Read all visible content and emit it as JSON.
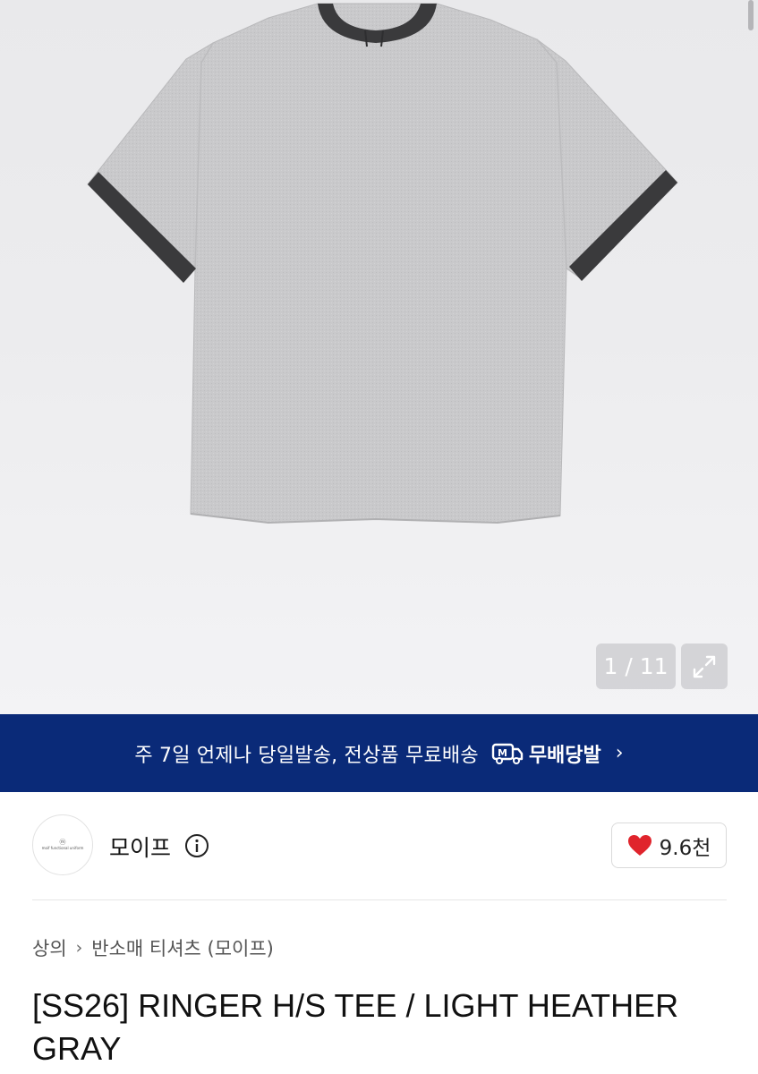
{
  "gallery": {
    "page_counter": "1 / 11",
    "image_alt": "Ringer H/S tee in light heather gray"
  },
  "banner": {
    "text": "주 7일 언제나 당일발송, 전상품 무료배송",
    "delivery_label": "무배당발",
    "color": "#0a2a78"
  },
  "shop": {
    "name": "모이프",
    "logo_text": "moif functional uniform",
    "like_count": "9.6천"
  },
  "breadcrumb": {
    "items": [
      "상의",
      "반소매 티셔츠 (모이프)"
    ]
  },
  "product": {
    "title": "[SS26] RINGER H/S TEE / LIGHT HEATHER GRAY"
  },
  "colors": {
    "heart": "#e0242c",
    "banner_bg": "#0a2a78"
  }
}
